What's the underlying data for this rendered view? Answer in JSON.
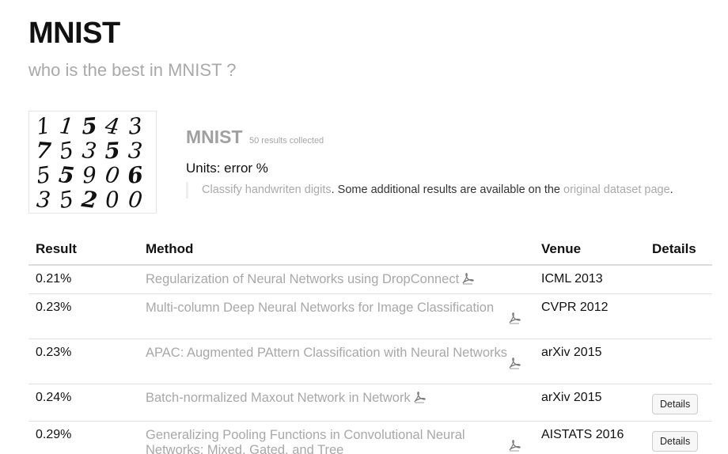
{
  "header": {
    "title": "MNIST",
    "subtitle": "who is the best in MNIST ?"
  },
  "dataset": {
    "image_alt": "MNIST handwritten digits sample",
    "digit_rows": [
      [
        "1",
        "1",
        "5",
        "4",
        "3"
      ],
      [
        "7",
        "5",
        "3",
        "5",
        "3"
      ],
      [
        "5",
        "5",
        "9",
        "0",
        "6"
      ],
      [
        "3",
        "5",
        "2",
        "0",
        "0"
      ]
    ],
    "name": "MNIST",
    "results_count": "50 results collected",
    "units": "Units: error %",
    "description": {
      "task_link": "Classify handwriten digits",
      "middle": ". Some additional results are available on the ",
      "source_link": "original dataset page",
      "end": "."
    }
  },
  "table": {
    "headers": {
      "result": "Result",
      "method": "Method",
      "venue": "Venue",
      "details": "Details"
    },
    "rows": [
      {
        "result": "0.21%",
        "method": "Regularization of Neural Networks using DropConnect",
        "venue": "ICML 2013",
        "details": ""
      },
      {
        "result": "0.23%",
        "method": "Multi-column Deep Neural Networks for Image Classification",
        "venue": "CVPR 2012",
        "details": ""
      },
      {
        "result": "0.23%",
        "method": "APAC: Augmented PAttern Classification with Neural Networks",
        "venue": "arXiv 2015",
        "details": ""
      },
      {
        "result": "0.24%",
        "method": "Batch-normalized Maxout Network in Network",
        "venue": "arXiv 2015",
        "details": "Details"
      },
      {
        "result": "0.29%",
        "method": "Generalizing Pooling Functions in Convolutional Neural Networks: Mixed, Gated, and Tree",
        "venue": "AISTATS 2016",
        "details": "Details"
      }
    ]
  },
  "icons": {
    "pdf": "pdf-icon"
  },
  "colors": {
    "link_gray": "#a8a8a8",
    "button_bg": "#f7f7f7",
    "border": "#e2e2e2"
  }
}
